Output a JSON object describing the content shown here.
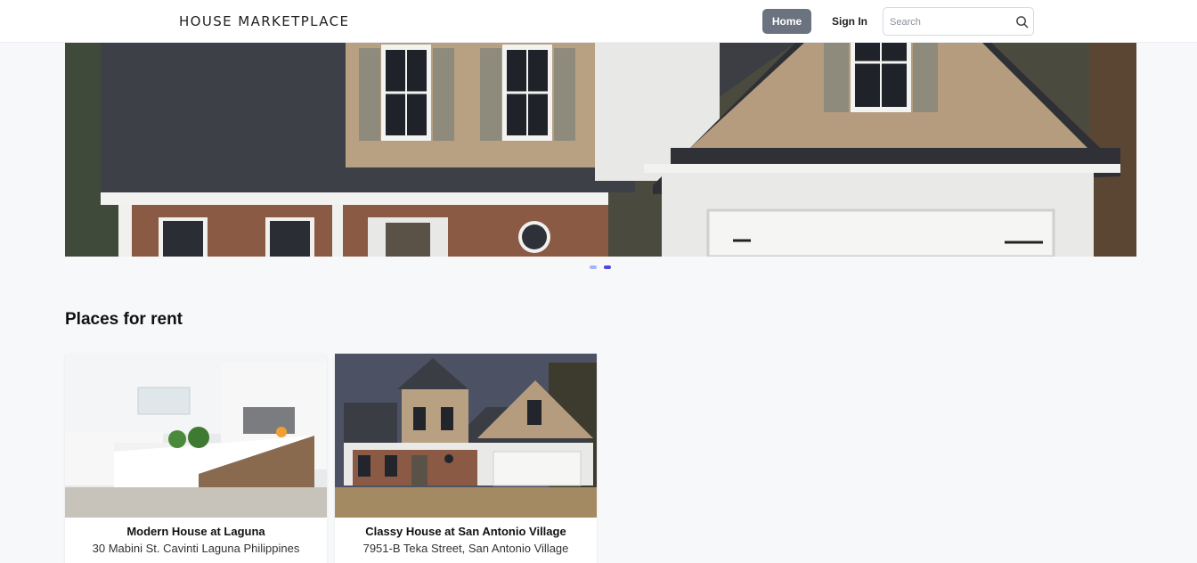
{
  "navbar": {
    "brand": "HOUSE MARKETPLACE",
    "home_label": "Home",
    "signin_label": "Sign In",
    "search_placeholder": "Search"
  },
  "carousel": {
    "active_slide": 2,
    "slide_count": 2
  },
  "section": {
    "title": "Places for rent"
  },
  "listings": [
    {
      "title": "Modern House at Laguna",
      "address": "30 Mabini St. Cavinti Laguna Philippines"
    },
    {
      "title": "Classy House at San Antonio Village",
      "address": "7951-B Teka Street, San Antonio Village"
    }
  ],
  "colors": {
    "accent": "#4f46e5",
    "home_button": "#6b7280",
    "background": "#f7f8fa"
  }
}
